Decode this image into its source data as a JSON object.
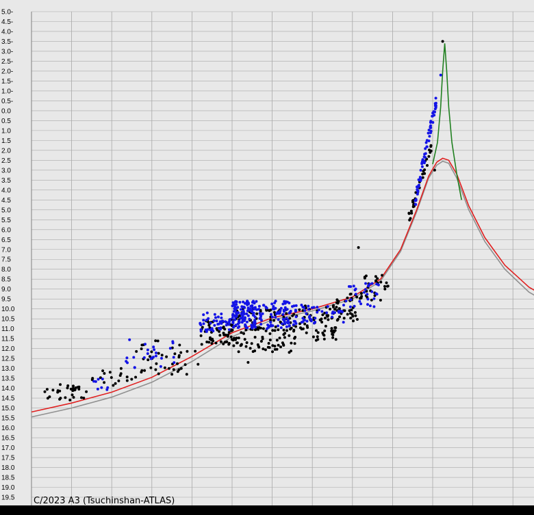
{
  "chart_data": {
    "type": "scatter",
    "title": "C/2023 A3 (Tsuchinshan-ATLAS)",
    "xlabel": "",
    "ylabel": "",
    "y_axis": {
      "inverted": true,
      "range": [
        -5.0,
        19.5
      ],
      "step": 0.5,
      "tick_labels": [
        "5.0-",
        "4.5-",
        "4.0-",
        "3.5-",
        "3.0-",
        "2.5-",
        "2.0-",
        "1.5-",
        "1.0-",
        "0.5-",
        "0.0",
        "0.5",
        "1.0",
        "1.5",
        "2.0",
        "2.5",
        "3.0",
        "3.5",
        "4.0",
        "4.5",
        "5.0",
        "5.5",
        "6.0",
        "6.5",
        "7.0",
        "7.5",
        "8.0",
        "8.5",
        "9.0",
        "9.5",
        "10.0",
        "10.5",
        "11.0",
        "11.5",
        "12.0",
        "12.5",
        "13.0",
        "13.5",
        "14.0",
        "14.5",
        "15.0",
        "15.5",
        "16.0",
        "16.5",
        "17.0",
        "17.5",
        "18.0",
        "18.5",
        "19.0",
        "19.5"
      ]
    },
    "x_axis": {
      "tick_labels_visible": false,
      "range": [
        0,
        13.4
      ],
      "grid_interval": 1
    },
    "grid": true,
    "colors": {
      "background": "#e8e8e8",
      "grid": "#a8a8a8",
      "black_points": "#000000",
      "blue_points": "#1414e6",
      "red_curve": "#e02020",
      "gray_curve": "#909090",
      "green_curve": "#208020"
    },
    "series": [
      {
        "kind": "points",
        "color": "black",
        "clusters": [
          {
            "x": [
              0.2,
              1.4
            ],
            "y": [
              13.8,
              14.6
            ],
            "n": 30
          },
          {
            "x": [
              1.5,
              2.6
            ],
            "y": [
              13.0,
              13.9
            ],
            "n": 18
          },
          {
            "x": [
              2.6,
              4.2
            ],
            "y": [
              11.6,
              13.3
            ],
            "n": 40
          },
          {
            "x": [
              4.2,
              5.2
            ],
            "y": [
              10.5,
              11.8
            ],
            "n": 60
          },
          {
            "x": [
              5.0,
              6.6
            ],
            "y": [
              10.0,
              12.2
            ],
            "n": 130
          },
          {
            "x": [
              6.6,
              7.6
            ],
            "y": [
              9.8,
              11.6
            ],
            "n": 70
          },
          {
            "x": [
              7.6,
              8.3
            ],
            "y": [
              9.2,
              10.7
            ],
            "n": 40
          },
          {
            "x": [
              8.3,
              8.9
            ],
            "y": [
              8.3,
              9.7
            ],
            "n": 25
          },
          {
            "x": [
              9.4,
              10.0
            ],
            "y": [
              1.6,
              5.5
            ],
            "n": 35
          }
        ],
        "outliers": [
          {
            "x": 8.15,
            "y": 6.9
          },
          {
            "x": 5.4,
            "y": 12.7
          },
          {
            "x": 3.5,
            "y": 13.3
          },
          {
            "x": 10.25,
            "y": -3.5
          },
          {
            "x": 10.05,
            "y": 3.0
          }
        ]
      },
      {
        "kind": "points",
        "color": "blue",
        "clusters": [
          {
            "x": [
              1.3,
              1.9
            ],
            "y": [
              13.5,
              14.1
            ],
            "n": 8
          },
          {
            "x": [
              2.3,
              3.6
            ],
            "y": [
              11.5,
              13.0
            ],
            "n": 25
          },
          {
            "x": [
              4.2,
              5.0
            ],
            "y": [
              10.2,
              11.2
            ],
            "n": 45
          },
          {
            "x": [
              5.0,
              5.6
            ],
            "y": [
              9.6,
              11.0
            ],
            "n": 120
          },
          {
            "x": [
              5.6,
              6.6
            ],
            "y": [
              9.6,
              11.0
            ],
            "n": 90
          },
          {
            "x": [
              6.6,
              7.8
            ],
            "y": [
              9.8,
              10.8
            ],
            "n": 40
          },
          {
            "x": [
              7.8,
              8.7
            ],
            "y": [
              8.7,
              9.9
            ],
            "n": 30
          },
          {
            "x": [
              9.55,
              10.1
            ],
            "y": [
              -0.6,
              4.7
            ],
            "n": 70
          }
        ],
        "outliers": [
          {
            "x": 10.2,
            "y": -1.8
          }
        ]
      },
      {
        "kind": "curve",
        "color": "red",
        "points": [
          [
            0,
            15.2
          ],
          [
            1,
            14.75
          ],
          [
            2,
            14.2
          ],
          [
            3,
            13.45
          ],
          [
            4,
            12.4
          ],
          [
            5,
            11.2
          ],
          [
            6,
            10.45
          ],
          [
            7,
            10.0
          ],
          [
            8,
            9.4
          ],
          [
            8.7,
            8.5
          ],
          [
            9.2,
            7.0
          ],
          [
            9.6,
            5.0
          ],
          [
            9.9,
            3.3
          ],
          [
            10.1,
            2.6
          ],
          [
            10.25,
            2.4
          ],
          [
            10.4,
            2.5
          ],
          [
            10.6,
            3.2
          ],
          [
            10.9,
            4.8
          ],
          [
            11.3,
            6.4
          ],
          [
            11.8,
            7.8
          ],
          [
            12.4,
            8.9
          ],
          [
            13.0,
            9.6
          ],
          [
            13.4,
            9.95
          ]
        ]
      },
      {
        "kind": "curve",
        "color": "gray",
        "points": [
          [
            0,
            15.45
          ],
          [
            1,
            15.0
          ],
          [
            2,
            14.45
          ],
          [
            3,
            13.7
          ],
          [
            4,
            12.65
          ],
          [
            5,
            11.4
          ],
          [
            6,
            10.55
          ],
          [
            7,
            10.1
          ],
          [
            8,
            9.5
          ],
          [
            8.7,
            8.6
          ],
          [
            9.2,
            7.1
          ],
          [
            9.6,
            5.1
          ],
          [
            9.9,
            3.4
          ],
          [
            10.1,
            2.75
          ],
          [
            10.25,
            2.55
          ],
          [
            10.4,
            2.65
          ],
          [
            10.6,
            3.4
          ],
          [
            10.9,
            5.0
          ],
          [
            11.3,
            6.6
          ],
          [
            11.8,
            8.0
          ],
          [
            12.4,
            9.15
          ],
          [
            13.0,
            9.85
          ],
          [
            13.4,
            10.15
          ]
        ]
      },
      {
        "kind": "curve",
        "color": "green",
        "points": [
          [
            10.0,
            2.7
          ],
          [
            10.12,
            1.6
          ],
          [
            10.2,
            -0.2
          ],
          [
            10.25,
            -2.0
          ],
          [
            10.3,
            -3.4
          ],
          [
            10.35,
            -2.0
          ],
          [
            10.4,
            -0.2
          ],
          [
            10.48,
            1.6
          ],
          [
            10.6,
            3.2
          ],
          [
            10.72,
            4.5
          ]
        ]
      }
    ]
  }
}
